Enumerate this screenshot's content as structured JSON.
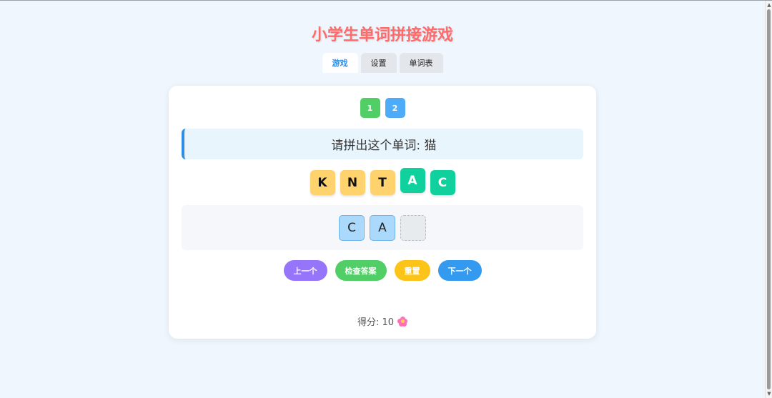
{
  "app": {
    "title": "小学生单词拼接游戏"
  },
  "tabs": [
    {
      "label": "游戏",
      "active": true
    },
    {
      "label": "设置",
      "active": false
    },
    {
      "label": "单词表",
      "active": false
    }
  ],
  "levels": [
    {
      "label": "1",
      "color": "#51cf66"
    },
    {
      "label": "2",
      "color": "#4dabf7"
    }
  ],
  "prompt": {
    "text": "请拼出这个单词: 猫"
  },
  "letter_pool": [
    {
      "letter": "K",
      "style": "yellow"
    },
    {
      "letter": "N",
      "style": "yellow"
    },
    {
      "letter": "T",
      "style": "yellow"
    },
    {
      "letter": "A",
      "style": "green"
    },
    {
      "letter": "C",
      "style": "green"
    }
  ],
  "answer_slots": [
    {
      "letter": "C",
      "filled": true
    },
    {
      "letter": "A",
      "filled": true
    },
    {
      "letter": "",
      "filled": false
    }
  ],
  "controls": [
    {
      "label": "上一个",
      "color": "#9775fa"
    },
    {
      "label": "检查答案",
      "color": "#51cf66"
    },
    {
      "label": "重置",
      "color": "#fcc419"
    },
    {
      "label": "下一个",
      "color": "#339af0"
    }
  ],
  "score": {
    "text": "得分: 10",
    "icon": "flower-icon"
  },
  "colors": {
    "title": "#ff6b6b",
    "accent": "#2f8de4",
    "tile_yellow": "#fed36e",
    "tile_green": "#10d19e"
  }
}
